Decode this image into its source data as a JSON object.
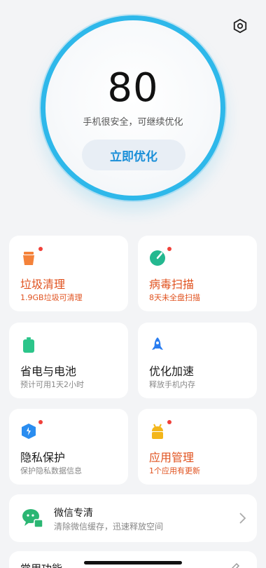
{
  "header": {
    "settings_icon": "gear-hex-icon"
  },
  "hero": {
    "score": "80",
    "status": "手机很安全，可继续优化",
    "button_label": "立即优化",
    "ring_color": "#2eb8ea"
  },
  "cards": [
    {
      "title": "垃圾清理",
      "sub": "1.9GB垃圾可清理",
      "icon": "trash-icon",
      "badge": true,
      "accent": "#f4823a"
    },
    {
      "title": "病毒扫描",
      "sub": "8天未全盘扫描",
      "icon": "radar-icon",
      "badge": true,
      "accent": "#24b890"
    },
    {
      "title": "省电与电池",
      "sub": "预计可用1天2小时",
      "icon": "battery-icon",
      "badge": false,
      "accent": "#2cc58a"
    },
    {
      "title": "优化加速",
      "sub": "释放手机内存",
      "icon": "rocket-icon",
      "badge": false,
      "accent": "#2a7df0"
    },
    {
      "title": "隐私保护",
      "sub": "保护隐私数据信息",
      "icon": "shield-icon",
      "badge": true,
      "accent": "#2a8df0"
    },
    {
      "title": "应用管理",
      "sub": "1个应用有更新",
      "icon": "android-icon",
      "badge": true,
      "accent": "#f3b61a"
    }
  ],
  "wechat": {
    "title": "微信专清",
    "sub": "清除微信缓存，迅速释放空间",
    "icon": "wechat-clean-icon",
    "accent": "#2bb673"
  },
  "more": {
    "title": "常用功能"
  },
  "colors": {
    "alert": "#e0521f",
    "badge": "#f0413a"
  }
}
